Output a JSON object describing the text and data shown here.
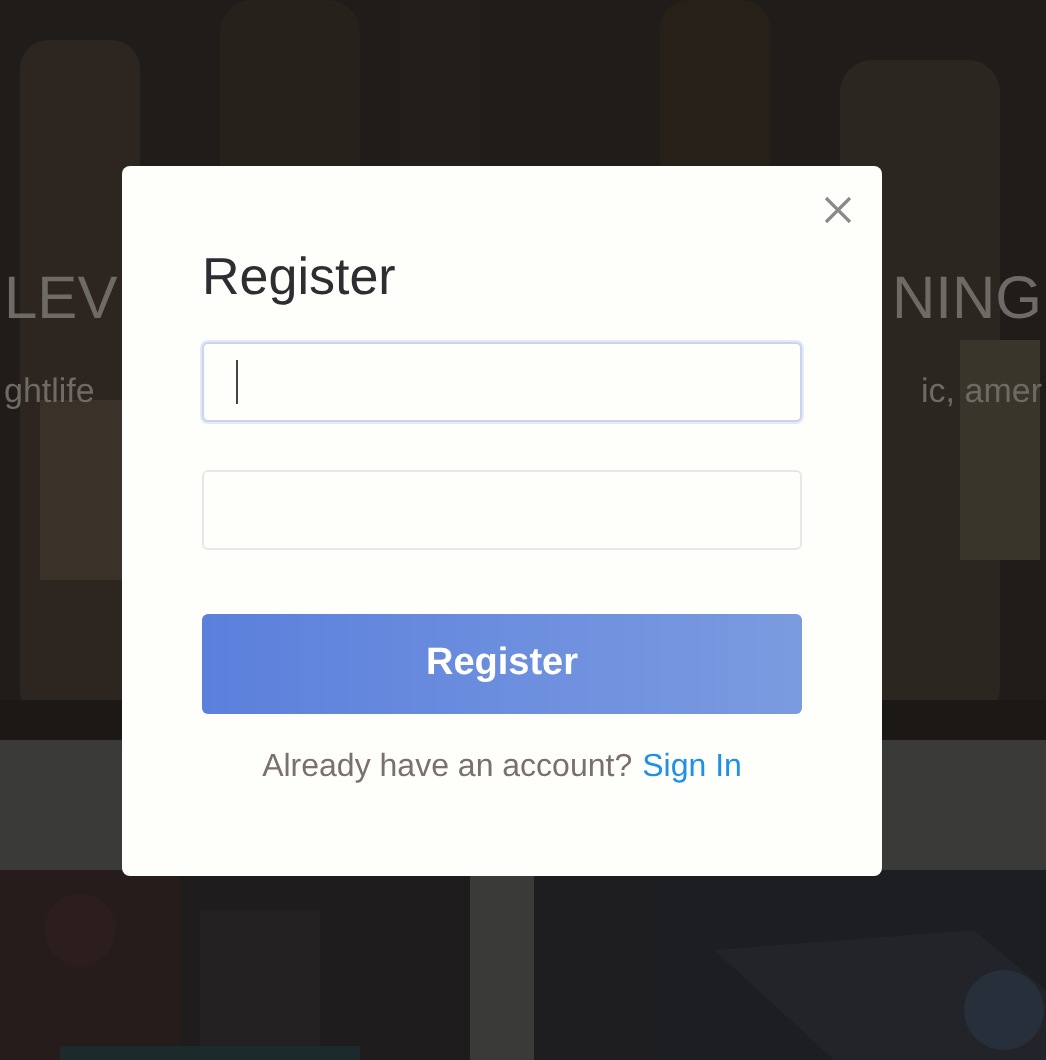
{
  "background": {
    "heading": [
      "LEV",
      "NING"
    ],
    "tagline": [
      "ghtlife",
      "ic, amer"
    ]
  },
  "dialog": {
    "title": "Register",
    "fields": [
      {
        "focused": true
      },
      {
        "focused": false
      }
    ],
    "submit": "Register",
    "prompt": "Already have an account?",
    "link": "Sign In"
  }
}
